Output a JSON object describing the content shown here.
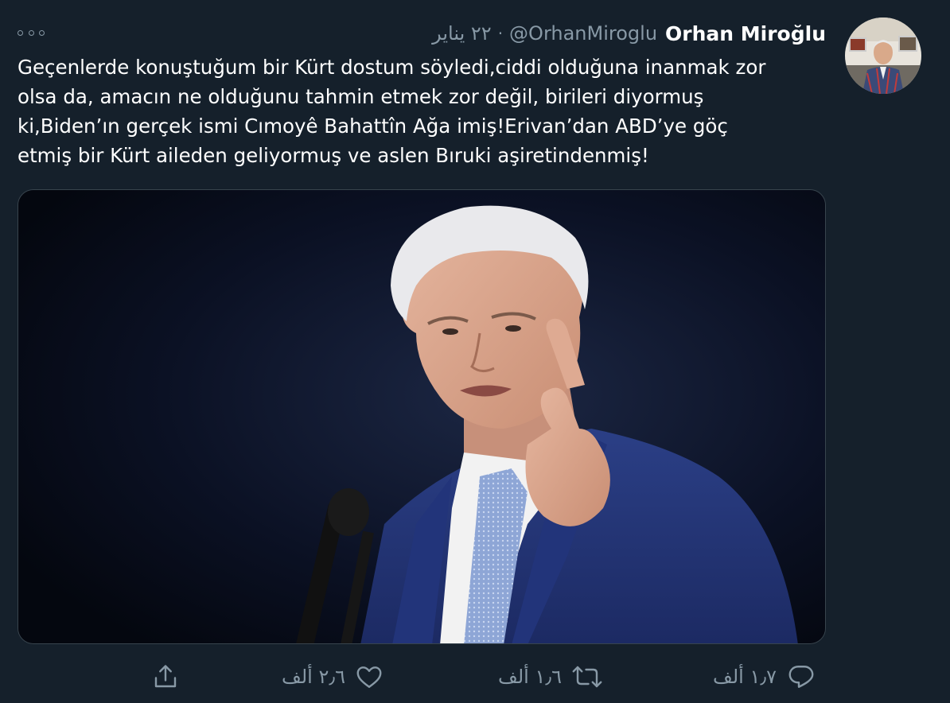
{
  "tweet": {
    "display_name": "Orhan Miroğlu",
    "handle": "@OrhanMiroglu",
    "separator": "·",
    "date": "٢٢ يناير",
    "text": "Geçenlerde konuştuğum bir Kürt dostum söyledi,ciddi olduğuna inanmak zor\nolsa da, amacın ne olduğunu tahmin etmek zor değil, birileri diyormuş\nki,Biden’ın gerçek ismi Cımoyê Bahattîn Ağa imiş!Erivan’dan ABD’ye göç\netmiş bir Kürt aileden geliyormuş ve aslen Bıruki aşiretindenmiş!",
    "more_icon": "more-dots-icon"
  },
  "actions": {
    "reply_count": "١٫٧ ألف",
    "retweet_count": "١٫٦ ألف",
    "like_count": "٢٫٦ ألف",
    "share_icon": "share-icon",
    "reply_icon": "reply-icon",
    "retweet_icon": "retweet-icon",
    "like_icon": "heart-icon"
  },
  "colors": {
    "background": "#15202b",
    "text": "#ffffff",
    "secondary": "#8899a6",
    "border": "#38444d"
  }
}
